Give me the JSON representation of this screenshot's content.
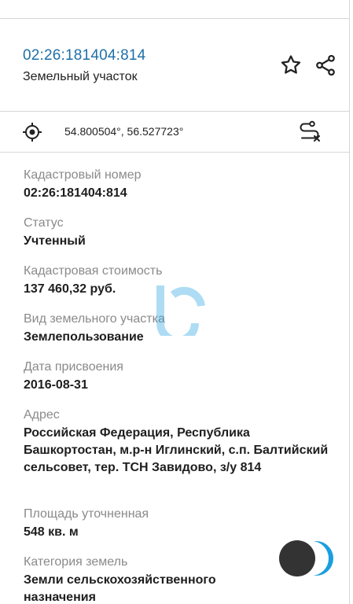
{
  "header": {
    "cadastral_link": "02:26:181404:814",
    "object_type": "Земельный участок"
  },
  "coords": {
    "text": "54.800504°, 56.527723°"
  },
  "fields": [
    {
      "label": "Кадастровый номер",
      "value": "02:26:181404:814"
    },
    {
      "label": "Статус",
      "value": "Учтенный"
    },
    {
      "label": "Кадастровая стоимость",
      "value": "137 460,32 руб."
    },
    {
      "label": "Вид земельного участка",
      "value": "Землепользование"
    },
    {
      "label": "Дата присвоения",
      "value": "2016-08-31"
    },
    {
      "label": "Адрес",
      "value": "Российская Федерация, Республика Башкортостан, м.р-н Иглинский, с.п. Балтийский сельсовет, тер. ТСН Завидово, з/у 814"
    },
    {
      "label": "Площадь уточненная",
      "value": "548 кв. м"
    },
    {
      "label": "Категория земель",
      "value": "Земли сельскохозяйственного назначения"
    }
  ],
  "icons": {
    "favorite": "star-icon",
    "share": "share-icon",
    "location": "target-icon",
    "route": "route-icon"
  },
  "colors": {
    "link": "#1f6fa8",
    "fab_dark": "#333333",
    "fab_accent": "#1a9ee0"
  }
}
